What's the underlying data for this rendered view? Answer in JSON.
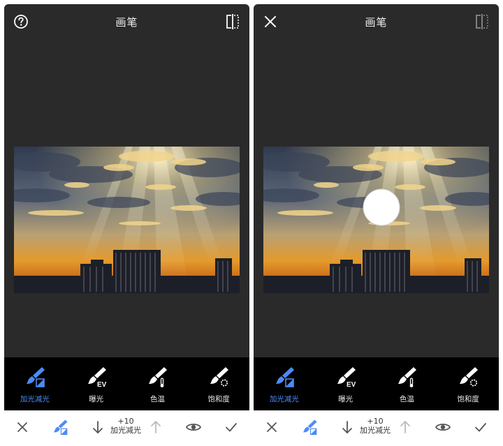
{
  "left_screen": {
    "title": "画笔",
    "tools": [
      {
        "label": "加光减光",
        "icon": "brush-dodge-burn-icon",
        "active": true
      },
      {
        "label": "曝光",
        "icon": "brush-exposure-ev-icon",
        "active": false
      },
      {
        "label": "色温",
        "icon": "brush-temperature-icon",
        "active": false
      },
      {
        "label": "饱和度",
        "icon": "brush-saturation-icon",
        "active": false
      }
    ],
    "bottom": {
      "value": "+10",
      "mode_label": "加光减光"
    }
  },
  "right_screen": {
    "title": "画笔",
    "tools": [
      {
        "label": "加光减光",
        "icon": "brush-dodge-burn-icon",
        "active": true
      },
      {
        "label": "曝光",
        "icon": "brush-exposure-ev-icon",
        "active": false
      },
      {
        "label": "色温",
        "icon": "brush-temperature-icon",
        "active": false
      },
      {
        "label": "饱和度",
        "icon": "brush-saturation-icon",
        "active": false
      }
    ],
    "bottom": {
      "value": "+10",
      "mode_label": "加光减光"
    }
  },
  "colors": {
    "accent": "#4c8bf5",
    "panel": "#2a2a2a",
    "toolbar": "#000000"
  }
}
